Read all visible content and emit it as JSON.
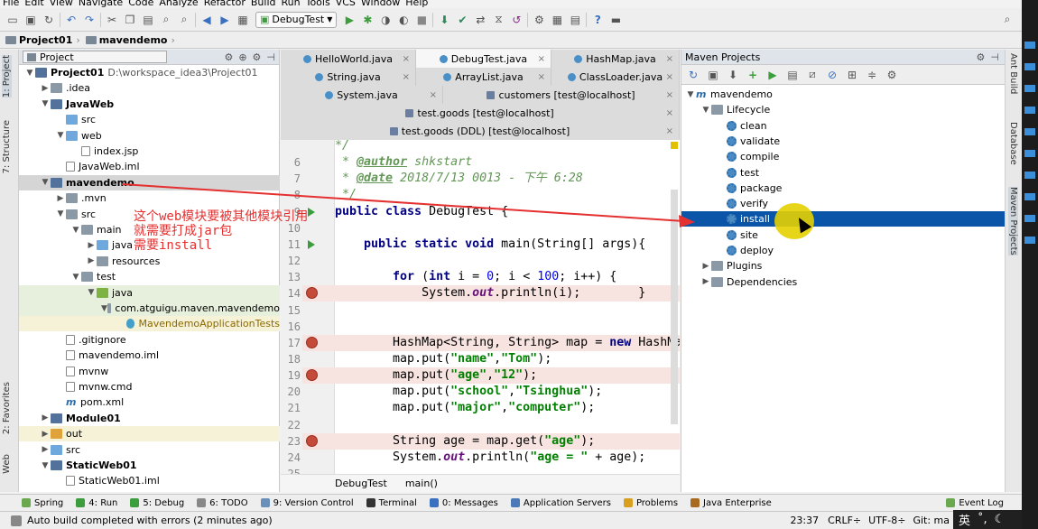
{
  "menu": [
    "File",
    "Edit",
    "View",
    "Navigate",
    "Code",
    "Analyze",
    "Refactor",
    "Build",
    "Run",
    "Tools",
    "VCS",
    "Window",
    "Help"
  ],
  "toolbar": {
    "run_config": "DebugTest"
  },
  "breadcrumbs": [
    "Project01",
    "mavendemo"
  ],
  "project_panel": {
    "title": "Project",
    "tree": [
      {
        "label": "Project01",
        "extra": "D:\\workspace_idea3\\Project01",
        "depth": 0,
        "arrow": "down",
        "icon": "mod",
        "bold": true
      },
      {
        "label": ".idea",
        "depth": 1,
        "arrow": "right",
        "icon": "fold"
      },
      {
        "label": "JavaWeb",
        "depth": 1,
        "arrow": "down",
        "icon": "mod",
        "bold": true
      },
      {
        "label": "src",
        "depth": 2,
        "arrow": "",
        "icon": "bfold"
      },
      {
        "label": "web",
        "depth": 2,
        "arrow": "down",
        "icon": "bfold"
      },
      {
        "label": "index.jsp",
        "depth": 3,
        "arrow": "",
        "icon": "file"
      },
      {
        "label": "JavaWeb.iml",
        "depth": 2,
        "arrow": "",
        "icon": "file"
      },
      {
        "label": "mavendemo",
        "depth": 1,
        "arrow": "down",
        "icon": "mod",
        "bold": true,
        "hl": true
      },
      {
        "label": ".mvn",
        "depth": 2,
        "arrow": "right",
        "icon": "fold"
      },
      {
        "label": "src",
        "depth": 2,
        "arrow": "down",
        "icon": "fold"
      },
      {
        "label": "main",
        "depth": 3,
        "arrow": "down",
        "icon": "fold"
      },
      {
        "label": "java",
        "depth": 4,
        "arrow": "right",
        "icon": "bfold"
      },
      {
        "label": "resources",
        "depth": 4,
        "arrow": "right",
        "icon": "fold"
      },
      {
        "label": "test",
        "depth": 3,
        "arrow": "down",
        "icon": "fold"
      },
      {
        "label": "java",
        "depth": 4,
        "arrow": "down",
        "icon": "gfold",
        "grn": true
      },
      {
        "label": "com.atguigu.maven.mavendemo",
        "depth": 5,
        "arrow": "down",
        "icon": "fold",
        "grn": true
      },
      {
        "label": "MavendemoApplicationTests",
        "depth": 6,
        "arrow": "",
        "icon": "cls",
        "grn": true,
        "yel": true
      },
      {
        "label": ".gitignore",
        "depth": 2,
        "arrow": "",
        "icon": "file"
      },
      {
        "label": "mavendemo.iml",
        "depth": 2,
        "arrow": "",
        "icon": "file"
      },
      {
        "label": "mvnw",
        "depth": 2,
        "arrow": "",
        "icon": "file"
      },
      {
        "label": "mvnw.cmd",
        "depth": 2,
        "arrow": "",
        "icon": "file"
      },
      {
        "label": "pom.xml",
        "depth": 2,
        "arrow": "",
        "icon": "m"
      },
      {
        "label": "Module01",
        "depth": 1,
        "arrow": "right",
        "icon": "mod",
        "bold": true
      },
      {
        "label": "out",
        "depth": 1,
        "arrow": "right",
        "icon": "ofold",
        "yel": true
      },
      {
        "label": "src",
        "depth": 1,
        "arrow": "right",
        "icon": "bfold"
      },
      {
        "label": "StaticWeb01",
        "depth": 1,
        "arrow": "down",
        "icon": "mod",
        "bold": true
      },
      {
        "label": "StaticWeb01.iml",
        "depth": 2,
        "arrow": "",
        "icon": "file"
      }
    ]
  },
  "editor_tabs": [
    [
      {
        "label": "HelloWorld.java",
        "active": false
      },
      {
        "label": "DebugTest.java",
        "active": true
      },
      {
        "label": "HashMap.java",
        "active": false
      }
    ],
    [
      {
        "label": "String.java",
        "active": false
      },
      {
        "label": "ArrayList.java",
        "active": false
      },
      {
        "label": "ClassLoader.java",
        "active": false
      }
    ],
    [
      {
        "label": "System.java",
        "active": false
      },
      {
        "label": "customers [test@localhost]",
        "active": false
      }
    ],
    [
      {
        "label": "test.goods [test@localhost]",
        "active": false
      }
    ],
    [
      {
        "label": "test.goods (DDL) [test@localhost]",
        "active": false
      }
    ]
  ],
  "code_lines": [
    {
      "n": "",
      "html": "<span class=\"doc\">*/</span>"
    },
    {
      "n": "6",
      "html": "<span class=\"doc\"> * </span><span class=\"doctag\">@author</span><span class=\"doc\"> shkstart</span>"
    },
    {
      "n": "7",
      "html": "<span class=\"doc\"> * </span><span class=\"doctag\">@date</span><span class=\"doc\"> 2018/7/13 0013 - 下午 6:28</span>"
    },
    {
      "n": "8",
      "html": "<span class=\"doc\"> */</span>"
    },
    {
      "n": "9",
      "html": "<span class=\"kw\">public class</span> DebugTest {"
    },
    {
      "n": "10",
      "html": ""
    },
    {
      "n": "11",
      "html": "    <span class=\"kw\">public static void</span> main(String[] args){"
    },
    {
      "n": "12",
      "html": ""
    },
    {
      "n": "13",
      "html": "        <span class=\"kw\">for</span> (<span class=\"kw\">int</span> i = <span class=\"num\">0</span>; i &lt; <span class=\"num\">100</span>; i++) {"
    },
    {
      "n": "14",
      "html": "            System.<span class=\"it\">out</span>.println(i);        }",
      "bp": true
    },
    {
      "n": "15",
      "html": ""
    },
    {
      "n": "16",
      "html": ""
    },
    {
      "n": "17",
      "html": "        HashMap&lt;String, String&gt; map = <span class=\"kw\">new</span> HashMap&lt;&gt;();",
      "bp": true
    },
    {
      "n": "18",
      "html": "        map.put(<span class=\"str\">\"name\"</span>,<span class=\"str\">\"Tom\"</span>);"
    },
    {
      "n": "19",
      "html": "        map.put(<span class=\"str\">\"age\"</span>,<span class=\"str\">\"12\"</span>);",
      "bp": true
    },
    {
      "n": "20",
      "html": "        map.put(<span class=\"str\">\"school\"</span>,<span class=\"str\">\"Tsinghua\"</span>);"
    },
    {
      "n": "21",
      "html": "        map.put(<span class=\"str\">\"major\"</span>,<span class=\"str\">\"computer\"</span>);"
    },
    {
      "n": "22",
      "html": ""
    },
    {
      "n": "23",
      "html": "        String age = map.get(<span class=\"str\">\"age\"</span>);",
      "bp": true
    },
    {
      "n": "24",
      "html": "        System.<span class=\"it\">out</span>.println(<span class=\"str\">\"age = \"</span> + age);"
    },
    {
      "n": "25",
      "html": ""
    }
  ],
  "editor_breadcrumb": [
    "DebugTest",
    "main()"
  ],
  "maven_panel": {
    "title": "Maven Projects",
    "tree": [
      {
        "label": "mavendemo",
        "depth": 0,
        "arrow": "down",
        "icon": "m"
      },
      {
        "label": "Lifecycle",
        "depth": 1,
        "arrow": "down",
        "icon": "fold"
      },
      {
        "label": "clean",
        "depth": 2,
        "icon": "gear"
      },
      {
        "label": "validate",
        "depth": 2,
        "icon": "gear"
      },
      {
        "label": "compile",
        "depth": 2,
        "icon": "gear"
      },
      {
        "label": "test",
        "depth": 2,
        "icon": "gear"
      },
      {
        "label": "package",
        "depth": 2,
        "icon": "gear"
      },
      {
        "label": "verify",
        "depth": 2,
        "icon": "gear"
      },
      {
        "label": "install",
        "depth": 2,
        "icon": "gear",
        "sel": true
      },
      {
        "label": "site",
        "depth": 2,
        "icon": "gear"
      },
      {
        "label": "deploy",
        "depth": 2,
        "icon": "gear"
      },
      {
        "label": "Plugins",
        "depth": 1,
        "arrow": "right",
        "icon": "fold"
      },
      {
        "label": "Dependencies",
        "depth": 1,
        "arrow": "right",
        "icon": "fold"
      }
    ]
  },
  "left_strip": [
    "1: Project",
    "7: Structure",
    "2: Favorites",
    "Web"
  ],
  "right_strip": [
    "Ant Build",
    "Database",
    "Maven Projects"
  ],
  "bottom_tools": [
    "Spring",
    "4: Run",
    "5: Debug",
    "6: TODO",
    "9: Version Control",
    "Terminal",
    "0: Messages",
    "Application Servers",
    "Problems",
    "Java Enterprise"
  ],
  "event_log": "Event Log",
  "status": {
    "message": "Auto build completed with errors (2 minutes ago)",
    "position": "23:37",
    "crlf": "CRLF÷",
    "encoding": "UTF-8÷",
    "git": "Git: ma"
  },
  "ime": {
    "lang": "英",
    "extra": "˚,"
  },
  "annotation": [
    "这个web模块要被其他模块引用",
    "就需要打成jar包",
    "需要install"
  ],
  "colors": {
    "selection": "#0a55a8",
    "breakpoint": "#c44a3a",
    "annotation": "#e53030"
  }
}
